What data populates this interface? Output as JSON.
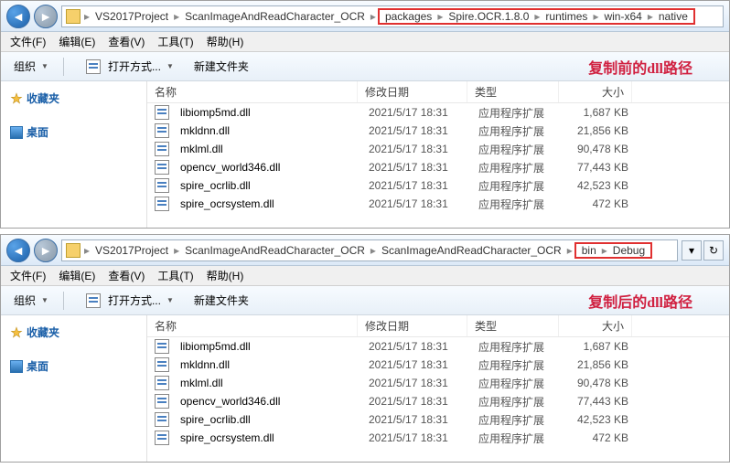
{
  "menubar": [
    "文件(F)",
    "编辑(E)",
    "查看(V)",
    "工具(T)",
    "帮助(H)"
  ],
  "toolbar": {
    "organize": "组织",
    "openwith": "打开方式...",
    "newfolder": "新建文件夹"
  },
  "columns": {
    "name": "名称",
    "date": "修改日期",
    "type": "类型",
    "size": "大小"
  },
  "sidebar": {
    "favorites": "收藏夹",
    "desktop": "桌面"
  },
  "top": {
    "breadcrumb_fixed": [
      "VS2017Project",
      "ScanImageAndReadCharacter_OCR"
    ],
    "breadcrumb_hl": [
      "packages",
      "Spire.OCR.1.8.0",
      "runtimes",
      "win-x64",
      "native"
    ],
    "annotation": "复制前的dll路径",
    "files": [
      {
        "name": "libiomp5md.dll",
        "date": "2021/5/17 18:31",
        "type": "应用程序扩展",
        "size": "1,687 KB"
      },
      {
        "name": "mkldnn.dll",
        "date": "2021/5/17 18:31",
        "type": "应用程序扩展",
        "size": "21,856 KB"
      },
      {
        "name": "mklml.dll",
        "date": "2021/5/17 18:31",
        "type": "应用程序扩展",
        "size": "90,478 KB"
      },
      {
        "name": "opencv_world346.dll",
        "date": "2021/5/17 18:31",
        "type": "应用程序扩展",
        "size": "77,443 KB"
      },
      {
        "name": "spire_ocrlib.dll",
        "date": "2021/5/17 18:31",
        "type": "应用程序扩展",
        "size": "42,523 KB"
      },
      {
        "name": "spire_ocrsystem.dll",
        "date": "2021/5/17 18:31",
        "type": "应用程序扩展",
        "size": "472 KB"
      }
    ]
  },
  "bottom": {
    "breadcrumb_fixed": [
      "VS2017Project",
      "ScanImageAndReadCharacter_OCR",
      "ScanImageAndReadCharacter_OCR"
    ],
    "breadcrumb_hl": [
      "bin",
      "Debug"
    ],
    "annotation": "复制后的dll路径",
    "files": [
      {
        "name": "libiomp5md.dll",
        "date": "2021/5/17 18:31",
        "type": "应用程序扩展",
        "size": "1,687 KB"
      },
      {
        "name": "mkldnn.dll",
        "date": "2021/5/17 18:31",
        "type": "应用程序扩展",
        "size": "21,856 KB"
      },
      {
        "name": "mklml.dll",
        "date": "2021/5/17 18:31",
        "type": "应用程序扩展",
        "size": "90,478 KB"
      },
      {
        "name": "opencv_world346.dll",
        "date": "2021/5/17 18:31",
        "type": "应用程序扩展",
        "size": "77,443 KB"
      },
      {
        "name": "spire_ocrlib.dll",
        "date": "2021/5/17 18:31",
        "type": "应用程序扩展",
        "size": "42,523 KB"
      },
      {
        "name": "spire_ocrsystem.dll",
        "date": "2021/5/17 18:31",
        "type": "应用程序扩展",
        "size": "472 KB"
      }
    ]
  }
}
